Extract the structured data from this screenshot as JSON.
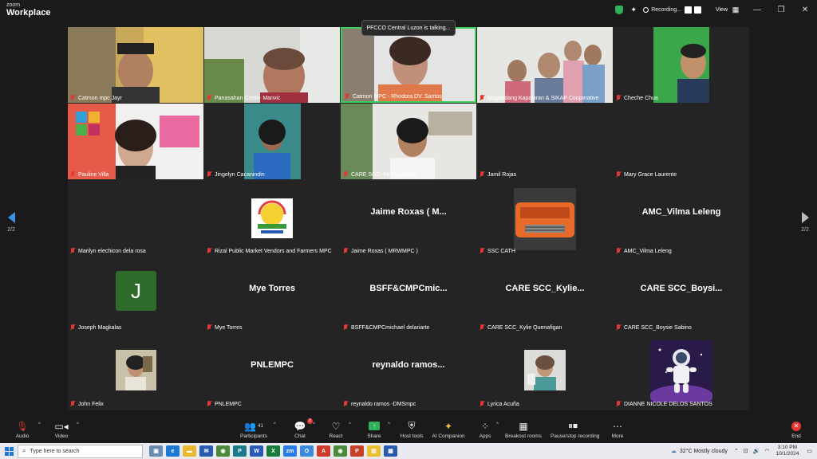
{
  "app": {
    "brand_top": "zoom",
    "brand_bottom": "Workplace"
  },
  "titlebar": {
    "recording": "Recording...",
    "view": "View"
  },
  "talking": "PFCCO Central Luzon is talking...",
  "pager": {
    "left": "2/2",
    "right": "2/2"
  },
  "tiles": [
    {
      "label": "Catmon mpc Jayr"
    },
    {
      "label": "Panasahan Credit- Marivic"
    },
    {
      "label": "Catmon MPC - Rhodora DV. Santos"
    },
    {
      "label": "Magandang Kapalaran & SIKAP Cooperative"
    },
    {
      "label": "Cheche Chua"
    },
    {
      "label": "Pauline Villa"
    },
    {
      "label": "Jingelyn Cacanindin"
    },
    {
      "label": "CARE SCC- Fe Bagalawis"
    },
    {
      "label": "Jamil Rojas"
    },
    {
      "label": "Mary Grace Laurente"
    },
    {
      "label": "Marilyn elechicon dela rosa"
    },
    {
      "label": "Rizal Public Market Vendors and Farmers MPC"
    },
    {
      "label": "Jaime Roxas ( MRWMPC )",
      "big": "Jaime Roxas ( M..."
    },
    {
      "label": "SSC CATH"
    },
    {
      "label": "AMC_Vilma Leleng",
      "big": "AMC_Vilma Leleng"
    },
    {
      "label": "Joseph Magkalas",
      "initial": "J"
    },
    {
      "label": "Mye Torres",
      "big": "Mye Torres"
    },
    {
      "label": "BSFF&CMPCmichael delariarte",
      "big": "BSFF&CMPCmic..."
    },
    {
      "label": "CARE SCC_Kylie Quenafigan",
      "big": "CARE  SCC_Kylie..."
    },
    {
      "label": "CARE SCC_Boysie Sabino",
      "big": "CARE  SCC_Boysi..."
    },
    {
      "label": "John Felix"
    },
    {
      "label": "PNLEMPC",
      "big": "PNLEMPC"
    },
    {
      "label": "reynaldo ramos -DMSmpc",
      "big": "reynaldo  ramos..."
    },
    {
      "label": "Lyrica Acuña"
    },
    {
      "label": "DIANNE NICOLE DELOS SANTOS"
    }
  ],
  "toolbar": {
    "audio": "Audio",
    "video": "Video",
    "participants": "Participants",
    "participants_count": "41",
    "chat": "Chat",
    "chat_badge": "2",
    "react": "React",
    "share": "Share",
    "host_tools": "Host tools",
    "ai_companion": "AI Companion",
    "apps": "Apps",
    "breakout": "Breakout rooms",
    "pause_stop": "Pause/stop recording",
    "more": "More",
    "end": "End"
  },
  "taskbar": {
    "search_placeholder": "Type here to search",
    "weather": "32°C  Mostly cloudy",
    "time": "3:10 PM",
    "date": "10/1/2024"
  },
  "colors": {
    "accent_blue": "#1e78d4",
    "share_green": "#2fb05a",
    "end_red": "#e53935",
    "muted_red": "#e53935"
  }
}
